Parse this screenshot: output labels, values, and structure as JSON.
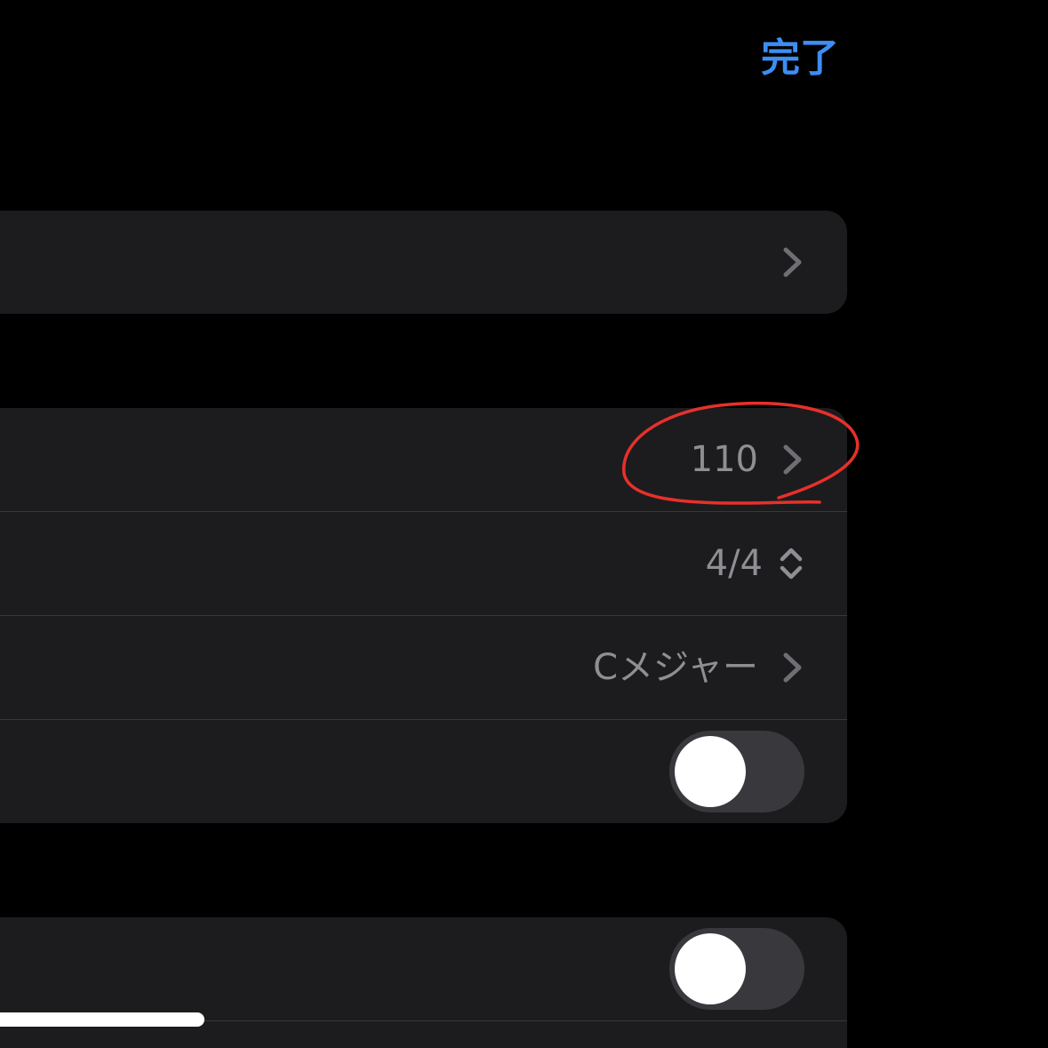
{
  "nav": {
    "done_label": "完了"
  },
  "settings": {
    "tempo_value": "110",
    "time_signature_value": "4/4",
    "key_value": "Cメジャー"
  },
  "toggles": {
    "toggle_1_on": false,
    "toggle_2_on": false
  },
  "colors": {
    "accent": "#3d8df5",
    "annotation": "#e8302a",
    "cell_background": "#1c1c1e",
    "secondary_text": "#8e8e93"
  },
  "icons": {
    "row_chevron": "chevron-right-icon",
    "stepper": "chevron-up-down-icon"
  }
}
